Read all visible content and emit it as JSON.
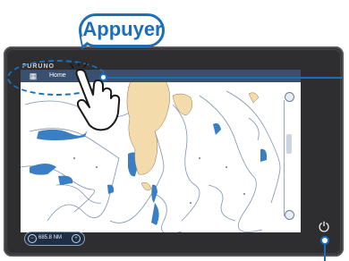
{
  "device": {
    "brand": "FURUNO"
  },
  "topbar": {
    "menu_icon": "menu-icon",
    "home_label": "Home"
  },
  "callout": {
    "text": "Appuyer"
  },
  "scale_bar": {
    "minus": "−",
    "value": "685.8",
    "unit": "NM",
    "plus": "+"
  },
  "power_button": {
    "icon": "power-icon",
    "glyph": "⏻"
  },
  "colors": {
    "accent": "#1a6fb8",
    "bezel": "#2e2e31",
    "land": "#f3dbab",
    "shallow_water": "#3a7fc4",
    "topbar": "#3a5070"
  }
}
